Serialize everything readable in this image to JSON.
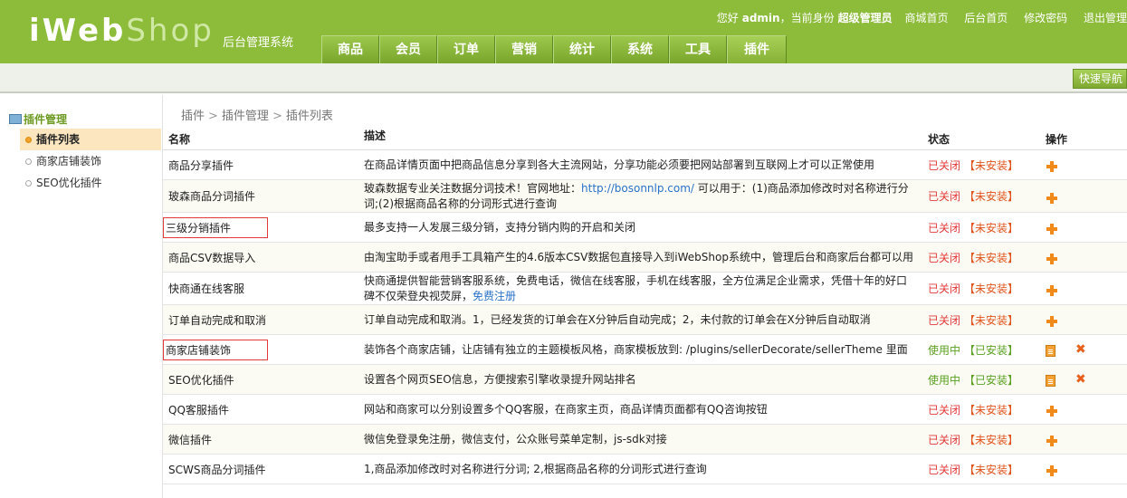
{
  "header": {
    "logo_main": "iWeb",
    "logo_accent": "Shop",
    "logo_sub": "后台管理系统",
    "greeting_prefix": "您好",
    "user": "admin",
    "greeting_mid": "，当前身份",
    "role": "超级管理员",
    "links": [
      "商城首页",
      "后台首页",
      "修改密码",
      "退出管理"
    ],
    "nav": [
      "商品",
      "会员",
      "订单",
      "营销",
      "统计",
      "系统",
      "工具",
      "插件"
    ],
    "quick_nav": "快速导航"
  },
  "sidebar": {
    "title": "插件管理",
    "items": [
      "插件列表",
      "商家店铺装饰",
      "SEO优化插件"
    ]
  },
  "breadcrumb": [
    "插件",
    "插件管理",
    "插件列表"
  ],
  "table": {
    "headers": [
      "名称",
      "描述",
      "状态",
      "操作"
    ],
    "rows": [
      {
        "name": "商品分享插件",
        "desc": "在商品详情页面中把商品信息分享到各大主流网站，分享功能必须要把网站部署到互联网上才可以正常使用",
        "status": "已关闭",
        "install": "【未安装】"
      },
      {
        "name": "玻森商品分词插件",
        "desc": "玻森数据专业关注数据分词技术！官网地址：",
        "link": "http://bosonnlp.com/",
        "desc2": "  可以用于：(1)商品添加修改时对名称进行分词;(2)根据商品名称的分词形式进行查询",
        "status": "已关闭",
        "install": "【未安装】"
      },
      {
        "name": "三级分销插件",
        "desc": "最多支持一人发展三级分销，支持分销内购的开启和关闭",
        "status": "已关闭",
        "install": "【未安装】"
      },
      {
        "name": "商品CSV数据导入",
        "desc": "由淘宝助手或者甩手工具箱产生的4.6版本CSV数据包直接导入到iWebShop系统中，管理后台和商家后台都可以用",
        "status": "已关闭",
        "install": "【未安装】"
      },
      {
        "name": "快商通在线客服",
        "desc": "快商通提供智能营销客服系统，免费电话，微信在线客服，手机在线客服，全方位满足企业需求，凭借十年的好口碑不仅荣登央视荧屏，",
        "link": "免费注册",
        "status": "已关闭",
        "install": "【未安装】"
      },
      {
        "name": "订单自动完成和取消",
        "desc": "订单自动完成和取消。1，已经发货的订单会在X分钟后自动完成；2，未付款的订单会在X分钟后自动取消",
        "status": "已关闭",
        "install": "【未安装】"
      },
      {
        "name": "商家店铺装饰",
        "desc": "装饰各个商家店铺，让店铺有独立的主题模板风格，商家模板放到: /plugins/sellerDecorate/sellerTheme 里面",
        "status": "使用中",
        "install": "【已安装】"
      },
      {
        "name": "SEO优化插件",
        "desc": "设置各个网页SEO信息，方便搜索引擎收录提升网站排名",
        "status": "使用中",
        "install": "【已安装】"
      },
      {
        "name": "QQ客服插件",
        "desc": "网站和商家可以分别设置多个QQ客服，在商家主页，商品详情页面都有QQ咨询按钮",
        "status": "已关闭",
        "install": "【未安装】"
      },
      {
        "name": "微信插件",
        "desc": "微信免登录免注册，微信支付，公众账号菜单定制，js-sdk对接",
        "status": "已关闭",
        "install": "【未安装】"
      },
      {
        "name": "SCWS商品分词插件",
        "desc": "1,商品添加修改时对名称进行分词; 2,根据商品名称的分词形式进行查询",
        "status": "已关闭",
        "install": "【未安装】"
      }
    ]
  },
  "colors": {
    "header_green": "#8dbb3a",
    "status_closed": "#e23a3a",
    "status_active": "#5aa020",
    "action_orange": "#f08a1a"
  }
}
